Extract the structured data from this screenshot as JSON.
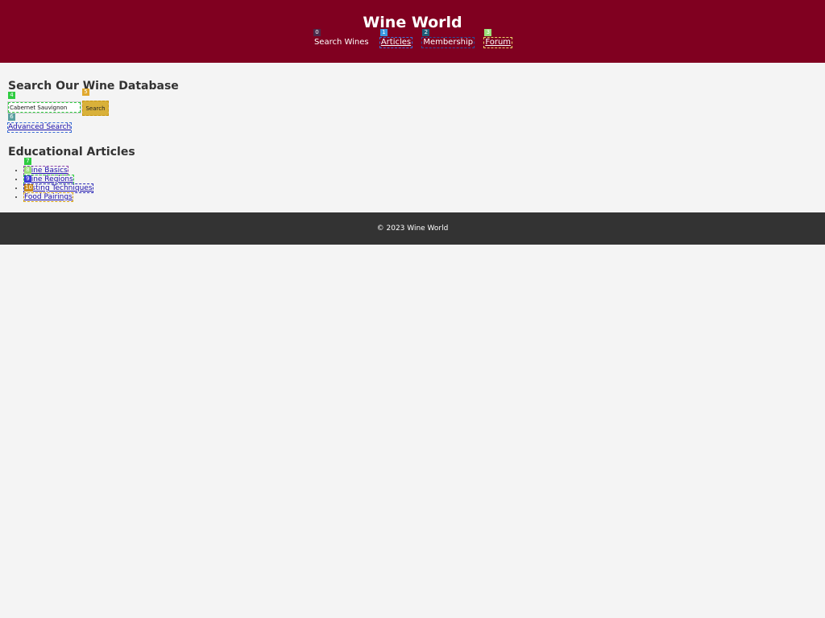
{
  "header": {
    "title": "Wine World",
    "nav": [
      {
        "label": "Search Wines",
        "badge": "0",
        "badge_color": "#4a2a4a"
      },
      {
        "label": "Articles",
        "badge": "1",
        "badge_color": "#3b9ae1"
      },
      {
        "label": "Membership",
        "badge": "2",
        "badge_color": "#1f5f7a"
      },
      {
        "label": "Forum",
        "badge": "3",
        "badge_color": "#9be07a"
      }
    ]
  },
  "search": {
    "heading": "Search Our Wine Database",
    "input_value": "Cabernet Sauvignon",
    "input_badge": "4",
    "input_badge_color": "#2ecc40",
    "button_label": "Search",
    "button_badge": "5",
    "button_badge_color": "#e0a82e",
    "advanced_label": "Advanced Search",
    "advanced_badge": "6",
    "advanced_badge_color": "#5aa0a0"
  },
  "articles": {
    "heading": "Educational Articles",
    "items": [
      {
        "label": "Wine Basics",
        "badge": "7",
        "badge_color": "#2ecc40"
      },
      {
        "label": "Wine Regions",
        "badge": "8",
        "badge_color": "#9be07a"
      },
      {
        "label": "Tasting Techniques",
        "badge": "9",
        "badge_color": "#3b3bd6"
      },
      {
        "label": "Food Pairings",
        "badge": "10",
        "badge_color": "#c98a1a"
      }
    ]
  },
  "footer": {
    "text": "© 2023 Wine World"
  },
  "colors": {
    "header_bg": "#800020",
    "footer_bg": "#333333",
    "page_bg": "#f4f4f4",
    "link": "#1a0dab"
  }
}
